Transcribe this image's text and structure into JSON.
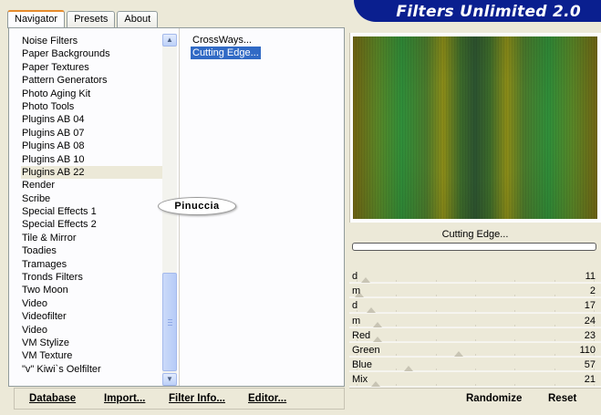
{
  "tabs": [
    {
      "label": "Navigator"
    },
    {
      "label": "Presets"
    },
    {
      "label": "About"
    }
  ],
  "app_title": "Filters Unlimited 2.0",
  "categories": [
    "Noise Filters",
    "Paper Backgrounds",
    "Paper Textures",
    "Pattern Generators",
    "Photo Aging Kit",
    "Photo Tools",
    "Plugins AB 04",
    "Plugins AB 07",
    "Plugins AB 08",
    "Plugins AB 10",
    "Plugins AB 22",
    "Render",
    "Scribe",
    "Special Effects 1",
    "Special Effects 2",
    "Tile & Mirror",
    "Toadies",
    "Tramages",
    "Tronds Filters",
    "Two Moon",
    "Video",
    "Videofilter",
    "Video",
    "VM Stylize",
    "VM Texture",
    "\"v\" Kiwi`s Oelfilter"
  ],
  "selected_category": "Plugins AB 22",
  "filters": [
    "CrossWays...",
    "Cutting Edge..."
  ],
  "selected_filter": "Cutting Edge...",
  "watermark": "Pinuccia",
  "filter_name": "Cutting Edge...",
  "params": [
    {
      "label": "d",
      "value": "11",
      "level": 0.04
    },
    {
      "label": "m",
      "value": "2",
      "level": 0.01
    },
    {
      "label": "d",
      "value": "17",
      "level": 0.06
    },
    {
      "label": "m",
      "value": "24",
      "level": 0.09
    },
    {
      "label": "Red",
      "value": "23",
      "level": 0.09
    },
    {
      "label": "Green",
      "value": "110",
      "level": 0.43
    },
    {
      "label": "Blue",
      "value": "57",
      "level": 0.22
    },
    {
      "label": "Mix",
      "value": "21",
      "level": 0.08
    }
  ],
  "buttons": {
    "database": "Database",
    "import": "Import...",
    "filter_info": "Filter Info...",
    "editor": "Editor...",
    "randomize": "Randomize",
    "reset": "Reset"
  }
}
